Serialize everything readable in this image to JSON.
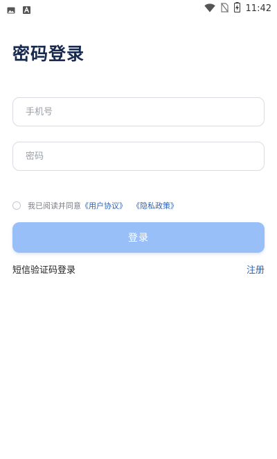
{
  "status_bar": {
    "time": "11:42",
    "icons": [
      "image-icon",
      "text-a-icon",
      "wifi-icon",
      "no-sim-icon",
      "battery-charging-icon"
    ]
  },
  "page": {
    "title": "密码登录"
  },
  "form": {
    "phone_placeholder": "手机号",
    "phone_value": "",
    "password_placeholder": "密码",
    "password_value": ""
  },
  "agreement": {
    "prefix": "我已阅读并同意",
    "user_agreement": "《用户协议》",
    "privacy_policy": "《隐私政策》",
    "checked": false
  },
  "actions": {
    "login_label": "登录",
    "sms_login_label": "短信验证码登录",
    "register_label": "注册"
  },
  "colors": {
    "title": "#182950",
    "login_button_bg": "#98bff8",
    "link": "#2b64b8",
    "input_border": "#d9dce3"
  }
}
